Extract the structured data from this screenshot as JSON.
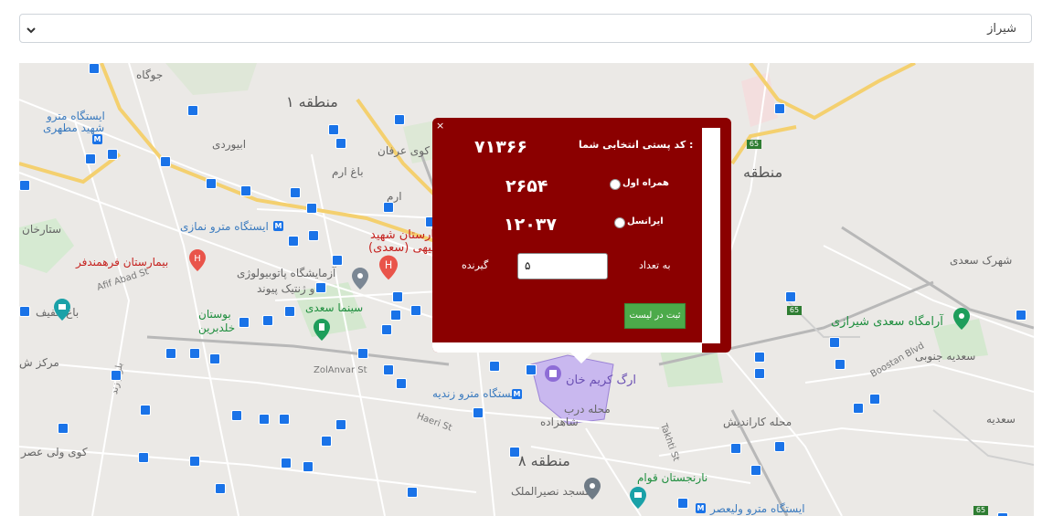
{
  "city_select": {
    "value": "شیراز"
  },
  "popup": {
    "title": "کد پستی انتخابی شما :",
    "code": "۷۱۳۶۶",
    "operators": [
      {
        "label": "همراه اول",
        "count": "۲۶۵۴"
      },
      {
        "label": "ایرانسل",
        "count": "۱۲۰۳۷"
      }
    ],
    "qty_label": "به تعداد",
    "qty_value": "۵",
    "recipients_label": "گیرنده",
    "submit_label": "ثبت در لیست",
    "close_glyph": "×"
  },
  "map": {
    "colors": {
      "background": "#ebe9e6",
      "highway": "#f6d36b",
      "park": "#c8e6c9",
      "district": "#b39ddb"
    },
    "labels": {
      "jowgah": "جوگاه",
      "metro_motahari_1": "ایستگاه مترو",
      "metro_motahari_2": "شهید مطهری",
      "district1": "منطقه ۱",
      "abivardi": "ابیوردی",
      "erfan": "کوی عرفان",
      "bagh_eram": "باغ ارم",
      "eram": "ارم",
      "metro_namazi": "ایستگاه مترو نمازی",
      "sattarkhan": "ستارخان",
      "hosp_farhmand": "بیمارستان فرهمندفر",
      "hosp_saadi_1": "بیمارستان شهید",
      "hosp_saadi_2": "فقیهی (سعدی)",
      "lab_1": "آزمایشگاه پاتوبیولوژی",
      "lab_2": "و ژنتیک پیوند",
      "cinema_saadi": "سینما سعدی",
      "afif_abad": "Afif Abad St",
      "bagh_afif": "باغ عفیف",
      "park_khaldebarin_1": "بوستان",
      "park_khaldebarin_2": "خلدبرین",
      "markaz": "مرکز ش",
      "zand_blvd": "بلوار زند",
      "zol_anvar": "ZolAnvar St",
      "haeri": "Haeri St",
      "metro_zandieh": "ایستگاه مترو زندیه",
      "arg_karimkhan": "ارگ کریم خان",
      "mahaleh_darb": "محله درب",
      "shahzadeh": "شاهزاده",
      "district8": "منطقه ۸",
      "kuy_vali_asr": "کوی ولی عصر",
      "nasir_mosque": "مسجد نصیرالملک",
      "narenjestan": "نارنجستان قوام",
      "metro_valiasr": "ایستگاه مترو ولیعصر",
      "karandish": "محله کاراندیش",
      "district_right": "منطقه",
      "shahrak_saadi": "شهرک سعدی",
      "saadi_tomb": "آرامگاه سعدی شیرازی",
      "saadieh_south": "سعدیه جنوبی",
      "saadieh": "سعدیه",
      "bustan_blvd": "Boostan Blvd",
      "takhti": "Takhti St",
      "sh65a": "65",
      "sh65b": "65",
      "sh65c": "65"
    }
  }
}
